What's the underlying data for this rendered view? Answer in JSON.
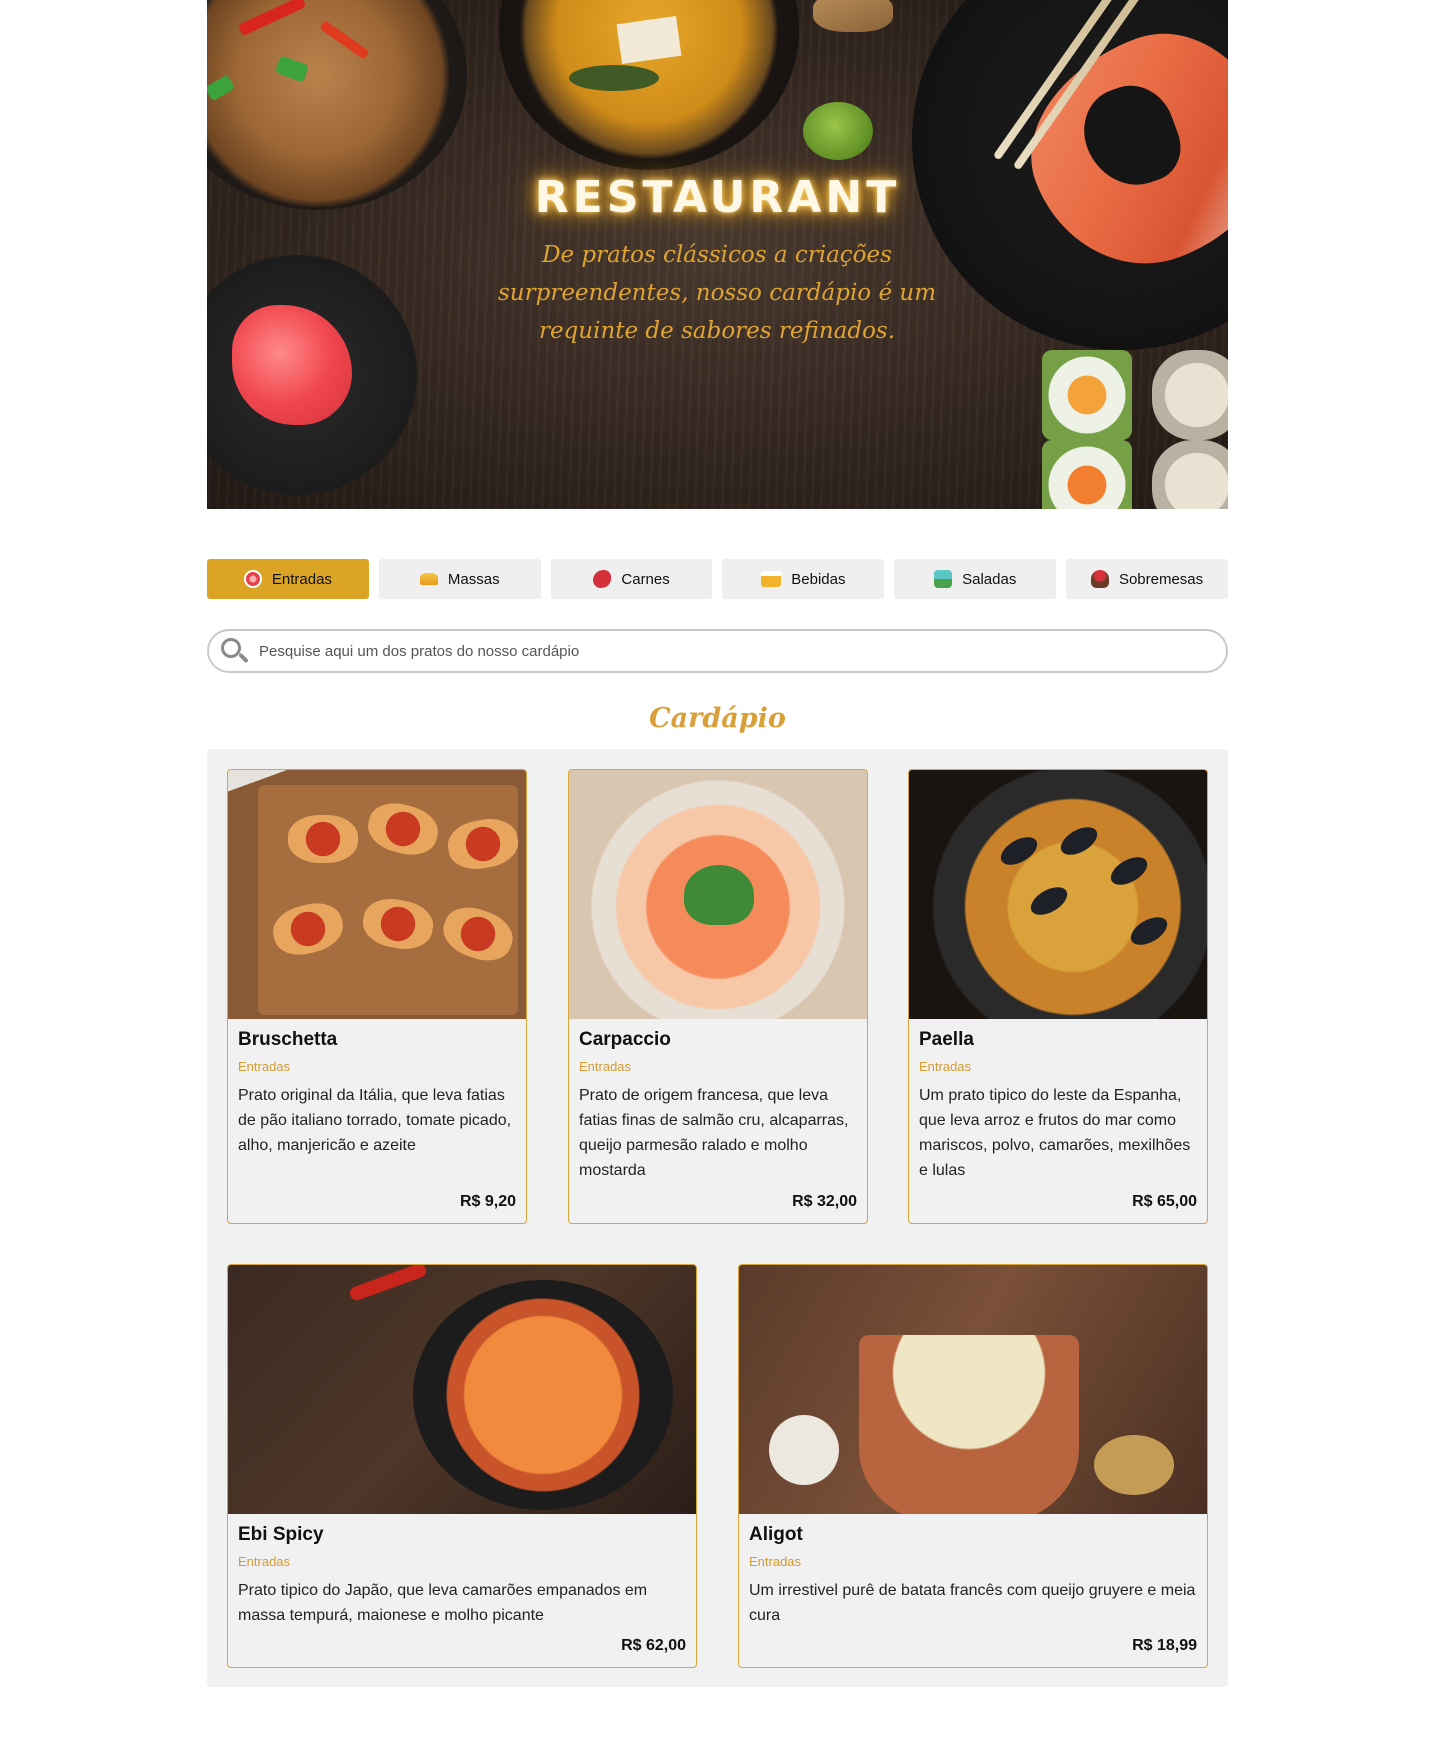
{
  "hero": {
    "title": "RESTAURANT",
    "subtitle": "De pratos clássicos a criações surpreendentes, nosso cardápio é um requinte de sabores refinados."
  },
  "categories": [
    {
      "label": "Entradas",
      "icon": "plate-icon",
      "active": true
    },
    {
      "label": "Massas",
      "icon": "pasta-icon",
      "active": false
    },
    {
      "label": "Carnes",
      "icon": "meat-icon",
      "active": false
    },
    {
      "label": "Bebidas",
      "icon": "drinks-icon",
      "active": false
    },
    {
      "label": "Saladas",
      "icon": "salad-icon",
      "active": false
    },
    {
      "label": "Sobremesas",
      "icon": "dessert-icon",
      "active": false
    }
  ],
  "search": {
    "placeholder": "Pesquise aqui um dos pratos do nosso cardápio",
    "value": ""
  },
  "menu": {
    "title": "Cardápio",
    "items": [
      {
        "name": "Bruschetta",
        "category": "Entradas",
        "description": "Prato original da Itália, que leva fatias de pão italiano torrado, tomate picado, alho, manjericão e azeite",
        "price": "R$ 9,20"
      },
      {
        "name": "Carpaccio",
        "category": "Entradas",
        "description": "Prato de origem francesa, que leva fatias finas de salmão cru, alcaparras, queijo parmesão ralado e molho mostarda",
        "price": "R$ 32,00"
      },
      {
        "name": "Paella",
        "category": "Entradas",
        "description": "Um prato tipico do leste da Espanha, que leva arroz e frutos do mar como mariscos, polvo, camarões, mexilhões e lulas",
        "price": "R$ 65,00"
      },
      {
        "name": "Ebi Spicy",
        "category": "Entradas",
        "description": "Prato tipico do Japão, que leva camarões empanados em massa tempurá, maionese e molho picante",
        "price": "R$ 62,00"
      },
      {
        "name": "Aligot",
        "category": "Entradas",
        "description": "Um irrestivel purê de batata francês com queijo gruyere e meia cura",
        "price": "R$ 18,99"
      }
    ]
  },
  "colors": {
    "accent": "#dba425",
    "accent_text": "#d49b30",
    "tab_bg": "#efefef",
    "panel_bg": "#f1f1f1"
  }
}
